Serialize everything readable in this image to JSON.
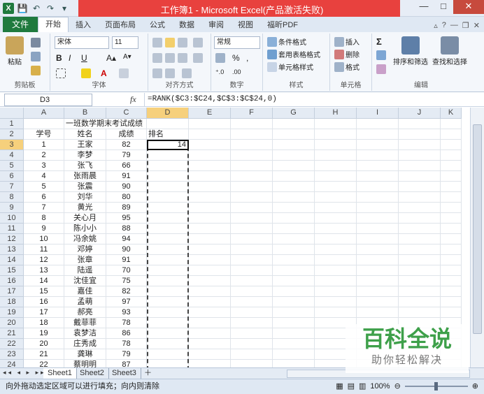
{
  "window": {
    "title": "工作簿1 - Microsoft Excel(产品激活失败)",
    "app_icon": "X",
    "controls": [
      "—",
      "□",
      "✕"
    ]
  },
  "ribbon_tabs": [
    "文件",
    "开始",
    "插入",
    "页面布局",
    "公式",
    "数据",
    "审阅",
    "视图",
    "福昕PDF"
  ],
  "ribbon": {
    "clipboard": {
      "label": "剪贴板",
      "paste": "粘贴"
    },
    "font": {
      "label": "字体",
      "name": "宋体",
      "size": "11",
      "bold": "B",
      "italic": "I",
      "underline": "U"
    },
    "alignment": {
      "label": "对齐方式"
    },
    "number": {
      "label": "数字",
      "format": "常规",
      "percent": "%",
      "comma": ","
    },
    "styles": {
      "label": "样式",
      "cond": "条件格式",
      "table": "套用表格格式",
      "cell": "单元格样式"
    },
    "cells": {
      "label": "单元格",
      "insert": "插入",
      "delete": "删除",
      "format": "格式"
    },
    "editing": {
      "label": "编辑",
      "sort": "排序和筛选",
      "find": "查找和选择",
      "sum": "Σ"
    }
  },
  "formula_bar": {
    "name_box": "D3",
    "fx": "fx",
    "formula": "=RANK($C3:$C24,$C$3:$C$24,0)"
  },
  "columns": [
    "A",
    "B",
    "C",
    "D",
    "E",
    "F",
    "G",
    "H",
    "I",
    "J",
    "K"
  ],
  "rows": [
    "1",
    "2",
    "3",
    "4",
    "5",
    "6",
    "7",
    "8",
    "9",
    "10",
    "11",
    "12",
    "13",
    "14",
    "15",
    "16",
    "17",
    "18",
    "19",
    "20",
    "21",
    "22",
    "23",
    "24"
  ],
  "sheet": {
    "title": "一班数学期末考试成绩",
    "headers": {
      "id": "学号",
      "name": "姓名",
      "score": "成绩",
      "rank": "排名"
    },
    "records": [
      {
        "id": "1",
        "name": "王家",
        "score": "82",
        "rank": "14"
      },
      {
        "id": "2",
        "name": "李梦",
        "score": "79",
        "rank": ""
      },
      {
        "id": "3",
        "name": "张飞",
        "score": "66",
        "rank": ""
      },
      {
        "id": "4",
        "name": "张雨晨",
        "score": "91",
        "rank": ""
      },
      {
        "id": "5",
        "name": "张震",
        "score": "90",
        "rank": ""
      },
      {
        "id": "6",
        "name": "刘华",
        "score": "80",
        "rank": ""
      },
      {
        "id": "7",
        "name": "黄光",
        "score": "89",
        "rank": ""
      },
      {
        "id": "8",
        "name": "关心月",
        "score": "95",
        "rank": ""
      },
      {
        "id": "9",
        "name": "陈小小",
        "score": "88",
        "rank": ""
      },
      {
        "id": "10",
        "name": "冯余姚",
        "score": "94",
        "rank": ""
      },
      {
        "id": "11",
        "name": "邓婷",
        "score": "90",
        "rank": ""
      },
      {
        "id": "12",
        "name": "张章",
        "score": "91",
        "rank": ""
      },
      {
        "id": "13",
        "name": "陆遥",
        "score": "70",
        "rank": ""
      },
      {
        "id": "14",
        "name": "沈佳宜",
        "score": "75",
        "rank": ""
      },
      {
        "id": "15",
        "name": "嘉佳",
        "score": "82",
        "rank": ""
      },
      {
        "id": "16",
        "name": "孟萌",
        "score": "97",
        "rank": ""
      },
      {
        "id": "17",
        "name": "郝亮",
        "score": "93",
        "rank": ""
      },
      {
        "id": "18",
        "name": "戴菲菲",
        "score": "78",
        "rank": ""
      },
      {
        "id": "19",
        "name": "袁梦洁",
        "score": "86",
        "rank": ""
      },
      {
        "id": "20",
        "name": "庄秀成",
        "score": "78",
        "rank": ""
      },
      {
        "id": "21",
        "name": "龚琳",
        "score": "79",
        "rank": ""
      },
      {
        "id": "22",
        "name": "蔡明明",
        "score": "87",
        "rank": ""
      }
    ]
  },
  "sheet_tabs": [
    "Sheet1",
    "Sheet2",
    "Sheet3"
  ],
  "status": {
    "message": "向外拖动选定区域可以进行填充；向内则清除",
    "zoom": "100%"
  },
  "watermark": {
    "line1": "百科全说",
    "line2": "助你轻松解决"
  },
  "colors": {
    "excel_green": "#1f7a3e",
    "title_red": "#e8413e",
    "selected_header": "#f6d07c"
  }
}
